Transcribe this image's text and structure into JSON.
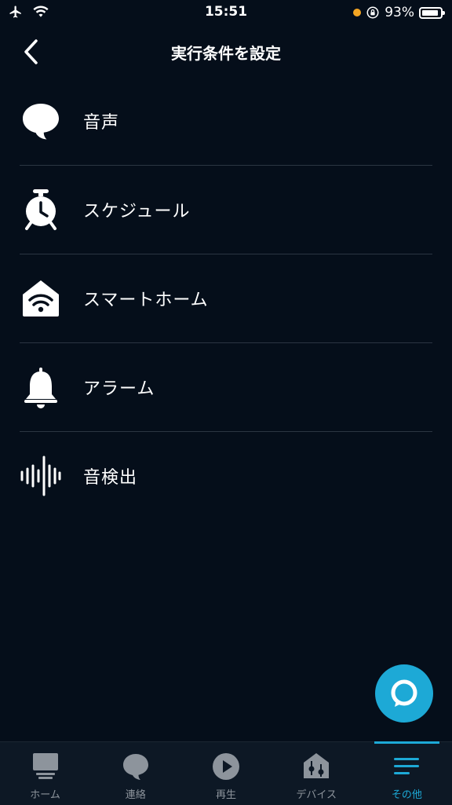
{
  "status_bar": {
    "time": "15:51",
    "battery": "93%",
    "battery_level": 0.93
  },
  "header": {
    "title": "実行条件を設定"
  },
  "menu": {
    "items": [
      {
        "label": "音声",
        "icon": "speech-bubble-icon"
      },
      {
        "label": "スケジュール",
        "icon": "alarm-clock-icon"
      },
      {
        "label": "スマートホーム",
        "icon": "smart-home-icon"
      },
      {
        "label": "アラーム",
        "icon": "bell-icon"
      },
      {
        "label": "音検出",
        "icon": "sound-wave-icon"
      }
    ]
  },
  "nav": {
    "items": [
      {
        "label": "ホーム",
        "icon": "home-icon"
      },
      {
        "label": "連絡",
        "icon": "chat-icon"
      },
      {
        "label": "再生",
        "icon": "play-icon"
      },
      {
        "label": "デバイス",
        "icon": "devices-icon"
      },
      {
        "label": "その他",
        "icon": "menu-icon",
        "active": true
      }
    ]
  },
  "colors": {
    "background": "#050e1a",
    "accent": "#1da9d6",
    "divider": "#2b3542",
    "nav_inactive": "#8d949c"
  }
}
